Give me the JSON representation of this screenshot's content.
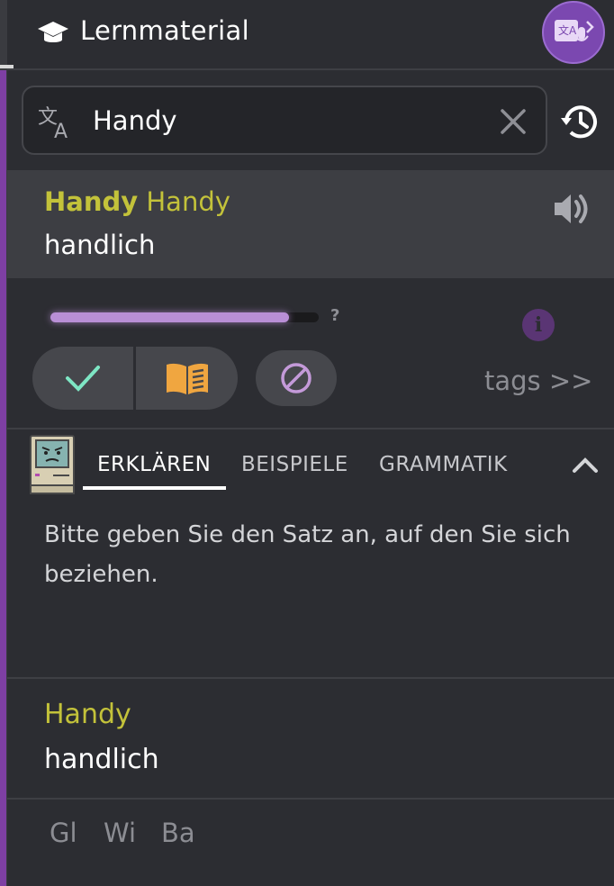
{
  "header": {
    "title": "Lernmaterial"
  },
  "search": {
    "value": "Handy"
  },
  "result": {
    "word_bold": "Handy",
    "word_alt": "Handy",
    "translation": "handlich"
  },
  "progress": {
    "fraction": 0.89,
    "help": "?"
  },
  "actions": {
    "tags_label": "tags >>"
  },
  "tabs": [
    {
      "label": "ERKLÄREN",
      "active": true
    },
    {
      "label": "BEISPIELE",
      "active": false
    },
    {
      "label": "GRAMMATIK",
      "active": false
    }
  ],
  "explain_text": "Bitte geben Sie den Satz an, auf den Sie sich beziehen.",
  "secondary": {
    "word": "Handy",
    "translation": "handlich"
  },
  "shortcuts": [
    "Gl",
    "Wi",
    "Ba"
  ],
  "colors": {
    "background": "#2c2d32",
    "accent_purple": "#7b48b0",
    "word_yellow": "#c3c23a",
    "check_green": "#7ee6c4",
    "book_orange": "#f0a640"
  },
  "icons": [
    "graduation-cap-icon",
    "translate-mic-icon",
    "translate-icon",
    "close-icon",
    "history-icon",
    "speaker-icon",
    "info-icon",
    "check-icon",
    "book-icon",
    "block-icon",
    "mac-avatar-icon",
    "chevron-up-icon"
  ]
}
